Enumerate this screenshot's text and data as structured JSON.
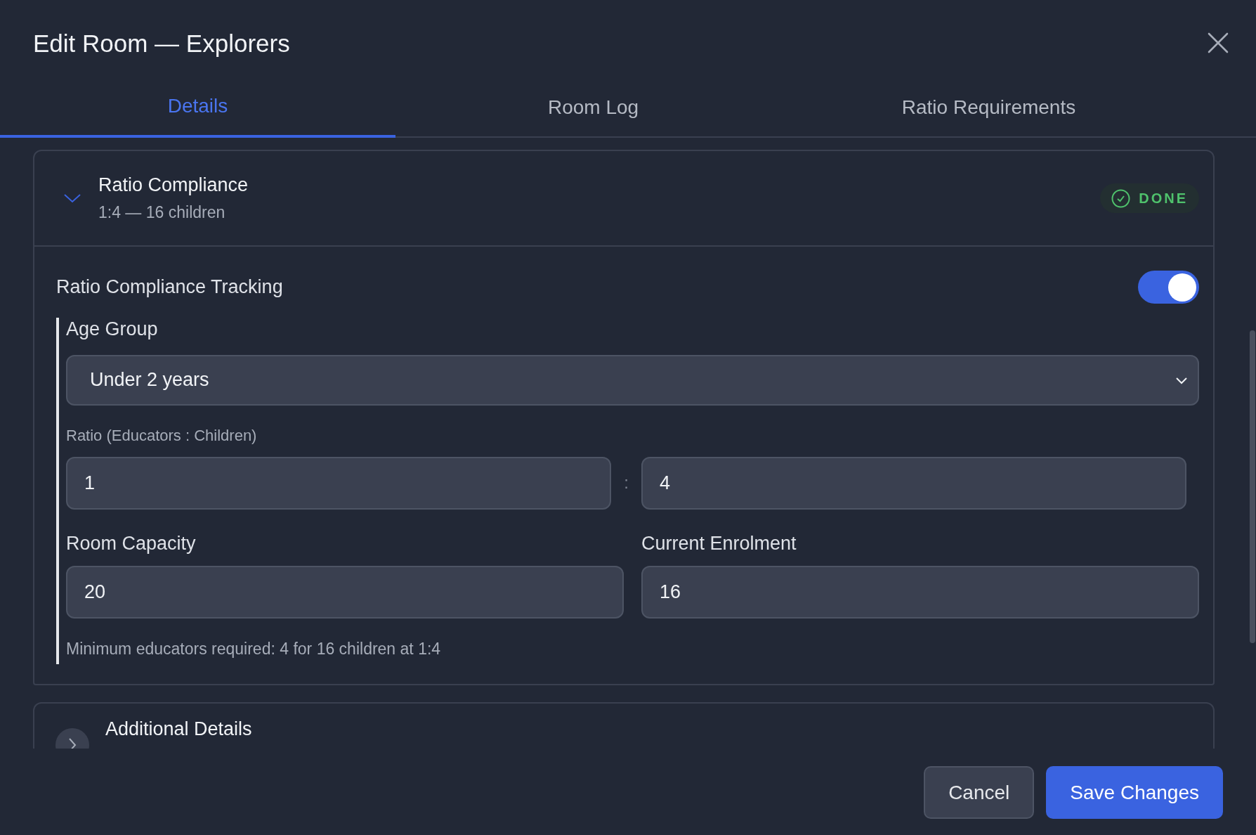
{
  "dialog": {
    "title": "Edit Room — Explorers"
  },
  "tabs": [
    {
      "label": "Details",
      "selected": true
    },
    {
      "label": "Room Log",
      "selected": false
    },
    {
      "label": "Ratio Requirements",
      "selected": false
    }
  ],
  "sections": [
    {
      "title": "Ratio Compliance",
      "subtitle": "1:4 — 16 children",
      "expanded": true,
      "badge": "DONE",
      "tracking": {
        "label": "Ratio Compliance Tracking",
        "on": true
      },
      "age_group": {
        "label": "Age Group",
        "value": "Under 2 years"
      },
      "ratio": {
        "label": "Ratio (Educators : Children)",
        "educators": "1",
        "separator": ":",
        "children": "4"
      },
      "capacity": {
        "label": "Room Capacity",
        "value": "20"
      },
      "enrolment": {
        "label": "Current Enrolment",
        "value": "16"
      },
      "hint": "Minimum educators required: 4 for 16 children at 1:4"
    },
    {
      "title": "Additional Details",
      "expanded": false
    }
  ],
  "buttons": [
    {
      "label": "Cancel",
      "kind": "secondary"
    },
    {
      "label": "Save Changes",
      "kind": "primary"
    }
  ]
}
